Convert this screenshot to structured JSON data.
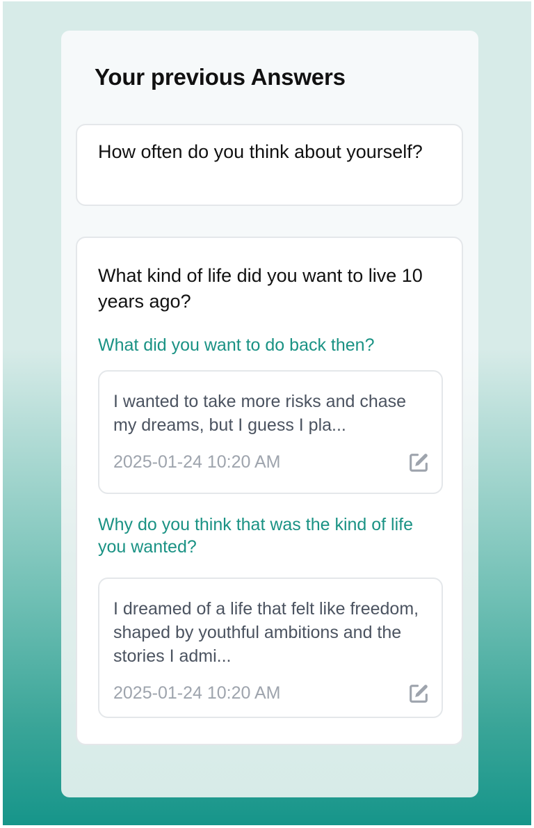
{
  "panel": {
    "title": "Your previous Answers"
  },
  "questions": [
    {
      "question": "How often do you think about yourself?",
      "answers": []
    },
    {
      "question": "What kind of life did you want to live 10 years ago?",
      "answers": [
        {
          "sub_question": "What did you want to do back then?",
          "text": "I wanted to take more risks and chase my dreams, but I guess I pla...",
          "timestamp": "2025-01-24 10:20 AM",
          "edit_icon": "edit-icon"
        },
        {
          "sub_question": "Why do you think that was the kind of life you wanted?",
          "text": "I dreamed of a life that felt like freedom, shaped by youthful ambitions and the stories I admi...",
          "timestamp": "2025-01-24 10:20 AM",
          "edit_icon": "edit-icon"
        }
      ]
    }
  ],
  "colors": {
    "accent": "#1a9284",
    "gradient_bottom": "#16958a",
    "gradient_top": "#d7ebe8",
    "muted_text": "#9ea4ad",
    "body_text": "#4b5360"
  }
}
